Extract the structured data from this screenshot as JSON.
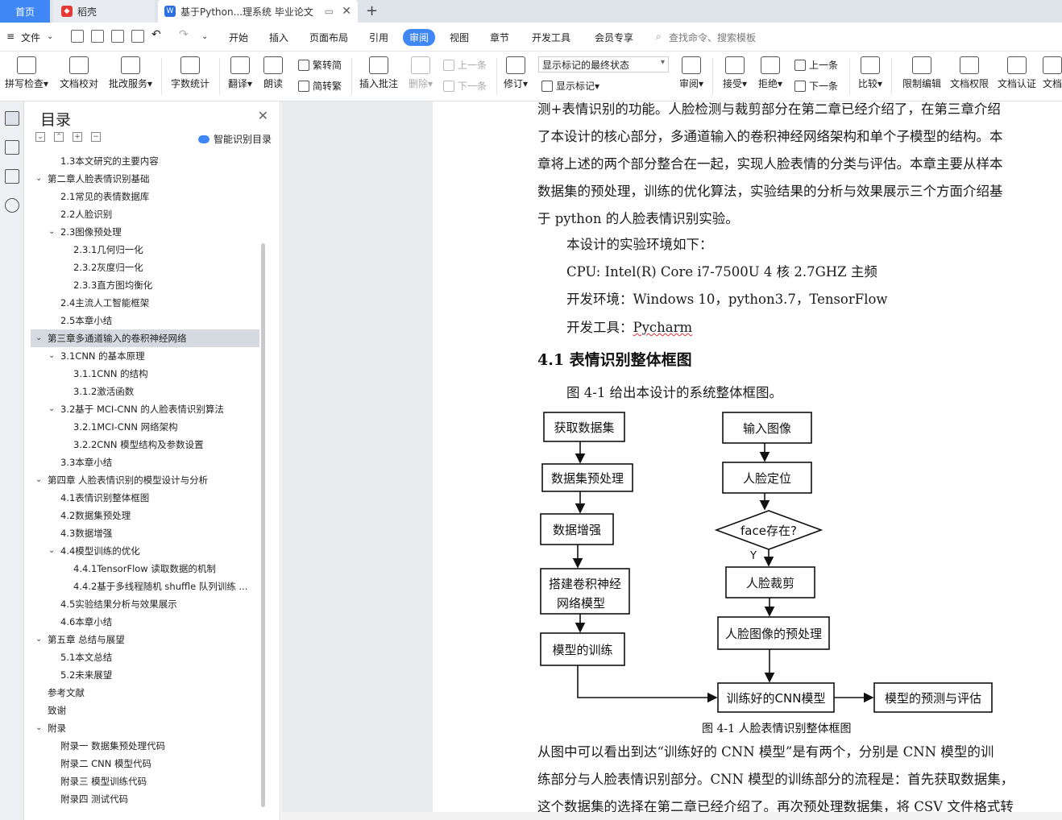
{
  "tabs": {
    "home": "首页",
    "daoke": "稻壳",
    "doc": "基于Python...理系统 毕业论文"
  },
  "menu": {
    "file": "文件",
    "items": [
      "开始",
      "插入",
      "页面布局",
      "引用",
      "审阅",
      "视图",
      "章节",
      "开发工具",
      "会员专享"
    ],
    "active": "审阅",
    "search": "查找命令、搜索模板"
  },
  "ribbon": {
    "spell": "拼写检查",
    "proof": "文档校对",
    "batch": "批改服务",
    "wordcount": "字数统计",
    "translate": "翻译",
    "read": "朗读",
    "trad": "繁转简",
    "simp": "简转繁",
    "insert_comment": "插入批注",
    "delete": "删除",
    "prev": "上一条",
    "next": "下一条",
    "revise": "修订",
    "markup_select": "显示标记的最终状态",
    "show_markup": "显示标记",
    "review": "审阅",
    "accept": "接受",
    "reject": "拒绝",
    "prev2": "上一条",
    "next2": "下一条",
    "compare": "比较",
    "restrict": "限制编辑",
    "rights": "文档权限",
    "certify": "文档认证",
    "more": "文档"
  },
  "toc": {
    "title": "目录",
    "ai": "智能识别目录",
    "items": [
      {
        "level": 2,
        "text": "1.3本文研究的主要内容",
        "caret": ""
      },
      {
        "level": 1,
        "text": "第二章人脸表情识别基础",
        "caret": "v"
      },
      {
        "level": 2,
        "text": "2.1常见的表情数据库",
        "caret": ""
      },
      {
        "level": 2,
        "text": "2.2人脸识别",
        "caret": ""
      },
      {
        "level": 2,
        "text": "2.3图像预处理",
        "caret": "v"
      },
      {
        "level": 3,
        "text": "2.3.1几何归一化",
        "caret": ""
      },
      {
        "level": 3,
        "text": "2.3.2灰度归一化",
        "caret": ""
      },
      {
        "level": 3,
        "text": "2.3.3直方图均衡化",
        "caret": ""
      },
      {
        "level": 2,
        "text": "2.4主流人工智能框架",
        "caret": ""
      },
      {
        "level": 2,
        "text": "2.5本章小结",
        "caret": ""
      },
      {
        "level": 1,
        "text": "第三章多通道输入的卷积神经网络",
        "caret": "v",
        "selected": true
      },
      {
        "level": 2,
        "text": "3.1CNN 的基本原理",
        "caret": "v"
      },
      {
        "level": 3,
        "text": "3.1.1CNN 的结构",
        "caret": ""
      },
      {
        "level": 3,
        "text": "3.1.2激活函数",
        "caret": ""
      },
      {
        "level": 2,
        "text": "3.2基于 MCI-CNN 的人脸表情识别算法",
        "caret": "v"
      },
      {
        "level": 3,
        "text": "3.2.1MCI-CNN 网络架构",
        "caret": ""
      },
      {
        "level": 3,
        "text": "3.2.2CNN 模型结构及参数设置",
        "caret": ""
      },
      {
        "level": 2,
        "text": "3.3本章小结",
        "caret": ""
      },
      {
        "level": 1,
        "text": "第四章 人脸表情识别的模型设计与分析",
        "caret": "v"
      },
      {
        "level": 2,
        "text": "4.1表情识别整体框图",
        "caret": ""
      },
      {
        "level": 2,
        "text": "4.2数据集预处理",
        "caret": ""
      },
      {
        "level": 2,
        "text": "4.3数据增强",
        "caret": ""
      },
      {
        "level": 2,
        "text": "4.4模型训练的优化",
        "caret": "v"
      },
      {
        "level": 3,
        "text": "4.4.1TensorFlow 读取数据的机制",
        "caret": ""
      },
      {
        "level": 3,
        "text": "4.4.2基于多线程随机 shuffle 队列训练 ...",
        "caret": ""
      },
      {
        "level": 2,
        "text": "4.5实验结果分析与效果展示",
        "caret": ""
      },
      {
        "level": 2,
        "text": "4.6本章小结",
        "caret": ""
      },
      {
        "level": 1,
        "text": "第五章 总结与展望",
        "caret": "v"
      },
      {
        "level": 2,
        "text": "5.1本文总结",
        "caret": ""
      },
      {
        "level": 2,
        "text": "5.2未来展望",
        "caret": ""
      },
      {
        "level": 1,
        "text": "参考文献",
        "caret": ""
      },
      {
        "level": 1,
        "text": "致谢",
        "caret": ""
      },
      {
        "level": 1,
        "text": "附录",
        "caret": "v"
      },
      {
        "level": 2,
        "text": "附录一 数据集预处理代码",
        "caret": ""
      },
      {
        "level": 2,
        "text": "附录二 CNN 模型代码",
        "caret": ""
      },
      {
        "level": 2,
        "text": "附录三 模型训练代码",
        "caret": ""
      },
      {
        "level": 2,
        "text": "附录四 测试代码",
        "caret": ""
      }
    ]
  },
  "doc": {
    "p1": [
      "测+表情识别的功能。人脸检测与裁剪部分在第二章已经介绍了，在第三章介绍",
      "了本设计的核心部分，多通道输入的卷积神经网络架构和单个子模型的结构。本",
      "章将上述的两个部分整合在一起，实现人脸表情的分类与评估。本章主要从样本",
      "数据集的预处理，训练的优化算法，实验结果的分析与效果展示三个方面介绍基",
      "于 python 的人脸表情识别实验。"
    ],
    "env_intro": "本设计的实验环境如下：",
    "cpu": "CPU: Intel(R) Core i7-7500U 4 核 2.7GHZ 主频",
    "devenv": "开发环境：Windows 10，python3.7，TensorFlow",
    "tool_label": "开发工具：",
    "tool_value": "Pycharm",
    "heading": "4.1 表情识别整体框图",
    "fig_intro": "图 4-1 给出本设计的系统整体框图。",
    "fig_caption": "图 4-1 人脸表情识别整体框图",
    "p2": [
      "从图中可以看出到达“训练好的 CNN 模型”是有两个，分别是 CNN 模型的训",
      "练部分与人脸表情识别部分。CNN 模型的训练部分的流程是：首先获取数据集，",
      "这个数据集的选择在第二章已经介绍了。再次预处理数据集，将 CSV 文件格式转"
    ]
  },
  "diagram": {
    "left": [
      "获取数据集",
      "数据集预处理",
      "数据增强",
      "搭建卷积神经",
      "网络模型",
      "模型的训练"
    ],
    "right": [
      "输入图像",
      "人脸定位",
      "face存在?",
      "Y",
      "人脸裁剪",
      "人脸图像的预处理"
    ],
    "bottom": [
      "训练好的CNN模型",
      "模型的预测与评估"
    ]
  }
}
